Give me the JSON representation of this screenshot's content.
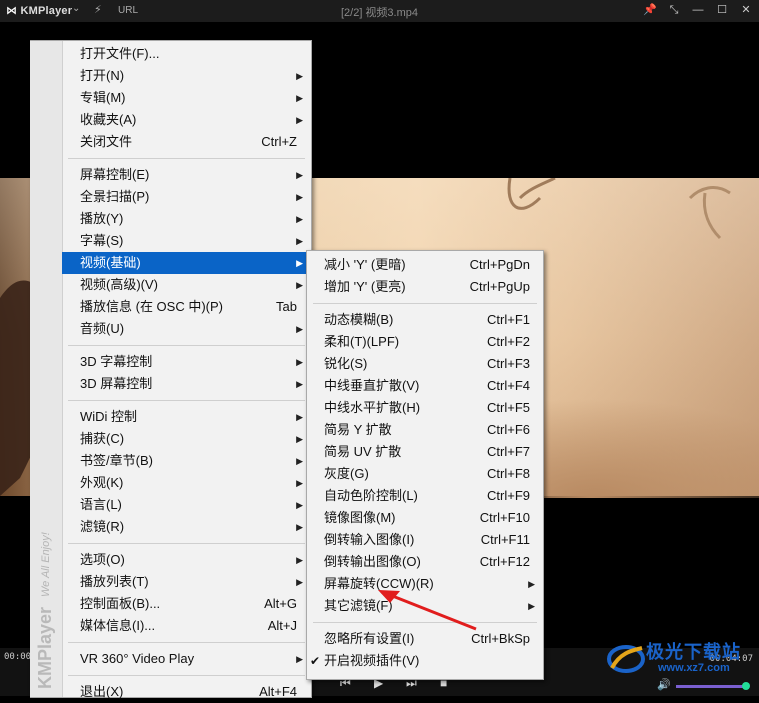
{
  "titlebar": {
    "app_name": "KMPlayer",
    "url_label": "URL",
    "title": "[2/2] 视频3.mp4"
  },
  "brand": {
    "name": "KMPlayer",
    "tagline": "We All Enjoy!"
  },
  "main_menu": {
    "items": [
      {
        "label": "打开文件(F)...",
        "accel": "",
        "submenu": false
      },
      {
        "label": "打开(N)",
        "accel": "",
        "submenu": true
      },
      {
        "label": "专辑(M)",
        "accel": "",
        "submenu": true
      },
      {
        "label": "收藏夹(A)",
        "accel": "",
        "submenu": true
      },
      {
        "label": "关闭文件",
        "accel": "Ctrl+Z",
        "submenu": false
      },
      {
        "sep": true
      },
      {
        "label": "屏幕控制(E)",
        "accel": "",
        "submenu": true
      },
      {
        "label": "全景扫描(P)",
        "accel": "",
        "submenu": true
      },
      {
        "label": "播放(Y)",
        "accel": "",
        "submenu": true
      },
      {
        "label": "字幕(S)",
        "accel": "",
        "submenu": true
      },
      {
        "label": "视频(基础)",
        "accel": "",
        "submenu": true,
        "highlighted": true
      },
      {
        "label": "视频(高级)(V)",
        "accel": "",
        "submenu": true
      },
      {
        "label": "播放信息 (在 OSC 中)(P)",
        "accel": "Tab",
        "submenu": false
      },
      {
        "label": "音频(U)",
        "accel": "",
        "submenu": true
      },
      {
        "sep": true
      },
      {
        "label": "3D 字幕控制",
        "accel": "",
        "submenu": true
      },
      {
        "label": "3D 屏幕控制",
        "accel": "",
        "submenu": true
      },
      {
        "sep": true
      },
      {
        "label": "WiDi 控制",
        "accel": "",
        "submenu": true
      },
      {
        "label": "捕获(C)",
        "accel": "",
        "submenu": true
      },
      {
        "label": "书签/章节(B)",
        "accel": "",
        "submenu": true
      },
      {
        "label": "外观(K)",
        "accel": "",
        "submenu": true
      },
      {
        "label": "语言(L)",
        "accel": "",
        "submenu": true
      },
      {
        "label": "滤镜(R)",
        "accel": "",
        "submenu": true
      },
      {
        "sep": true
      },
      {
        "label": "选项(O)",
        "accel": "",
        "submenu": true
      },
      {
        "label": "播放列表(T)",
        "accel": "",
        "submenu": true
      },
      {
        "label": "控制面板(B)...",
        "accel": "Alt+G",
        "submenu": false
      },
      {
        "label": "媒体信息(I)...",
        "accel": "Alt+J",
        "submenu": false
      },
      {
        "sep": true
      },
      {
        "label": "VR 360° Video Play",
        "accel": "",
        "submenu": true
      },
      {
        "sep": true
      },
      {
        "label": "退出(X)",
        "accel": "Alt+F4",
        "submenu": false
      }
    ]
  },
  "sub_menu": {
    "items": [
      {
        "label": "减小 'Y' (更暗)",
        "accel": "Ctrl+PgDn",
        "submenu": false
      },
      {
        "label": "增加 'Y' (更亮)",
        "accel": "Ctrl+PgUp",
        "submenu": false
      },
      {
        "sep": true
      },
      {
        "label": "动态模糊(B)",
        "accel": "Ctrl+F1",
        "submenu": false
      },
      {
        "label": "柔和(T)(LPF)",
        "accel": "Ctrl+F2",
        "submenu": false
      },
      {
        "label": "锐化(S)",
        "accel": "Ctrl+F3",
        "submenu": false
      },
      {
        "label": "中线垂直扩散(V)",
        "accel": "Ctrl+F4",
        "submenu": false
      },
      {
        "label": "中线水平扩散(H)",
        "accel": "Ctrl+F5",
        "submenu": false
      },
      {
        "label": "简易 Y 扩散",
        "accel": "Ctrl+F6",
        "submenu": false
      },
      {
        "label": "简易 UV 扩散",
        "accel": "Ctrl+F7",
        "submenu": false
      },
      {
        "label": "灰度(G)",
        "accel": "Ctrl+F8",
        "submenu": false
      },
      {
        "label": "自动色阶控制(L)",
        "accel": "Ctrl+F9",
        "submenu": false
      },
      {
        "label": "镜像图像(M)",
        "accel": "Ctrl+F10",
        "submenu": false
      },
      {
        "label": "倒转输入图像(I)",
        "accel": "Ctrl+F11",
        "submenu": false
      },
      {
        "label": "倒转输出图像(O)",
        "accel": "Ctrl+F12",
        "submenu": false
      },
      {
        "label": "屏幕旋转(CCW)(R)",
        "accel": "",
        "submenu": true
      },
      {
        "label": "其它滤镜(F)",
        "accel": "",
        "submenu": true
      },
      {
        "sep": true
      },
      {
        "label": "忽略所有设置(I)",
        "accel": "Ctrl+BkSp",
        "submenu": false
      },
      {
        "label": "开启视频插件(V)",
        "accel": "",
        "submenu": false,
        "checked": true
      }
    ]
  },
  "controls": {
    "time_left": "00:00",
    "time_right": "00:04:07",
    "volume_fraction": 0.95
  },
  "watermark": {
    "text": "极光下载站",
    "url": "www.xz7.com"
  },
  "colors": {
    "highlight": "#0a64c7",
    "annotation_arrow": "#e11d1d"
  }
}
